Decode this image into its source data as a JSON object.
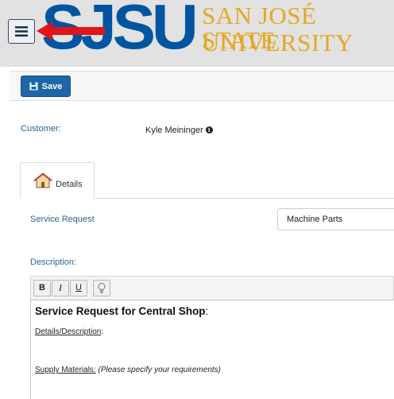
{
  "header": {
    "logo_text": "SJSU",
    "university_line1": "SAN JOSÉ STATE",
    "university_line2": "UNIVERSITY",
    "menu_icon": "hamburger-icon",
    "annotation": "red-arrow",
    "colors": {
      "brand_blue": "#0055a2",
      "brand_gold": "#e5a823",
      "arrow_red": "#e0141a"
    }
  },
  "toolbar": {
    "save_label": "Save",
    "save_icon": "floppy-disk-icon",
    "save_color": "#1e66a7"
  },
  "customer": {
    "label": "Customer:",
    "name": "Kyle Meininger",
    "info_icon": "info-circle-icon"
  },
  "tabs": [
    {
      "label": "Details",
      "icon": "house-icon",
      "active": true
    }
  ],
  "form": {
    "service_request_label": "Service Request",
    "service_request_value": "Machine Parts",
    "description_label": "Description:"
  },
  "editor": {
    "buttons": [
      {
        "label": "B",
        "name": "bold"
      },
      {
        "label": "I",
        "name": "italic"
      },
      {
        "label": "U",
        "name": "underline"
      }
    ],
    "extra_icon": "lightbulb-icon",
    "heading": "Service Request for Central Shop",
    "heading_suffix": ":",
    "details_label": "Details/Description",
    "details_suffix": ":",
    "supply_label": "Supply Materials:",
    "supply_note": "(Please specify your requirements)"
  }
}
